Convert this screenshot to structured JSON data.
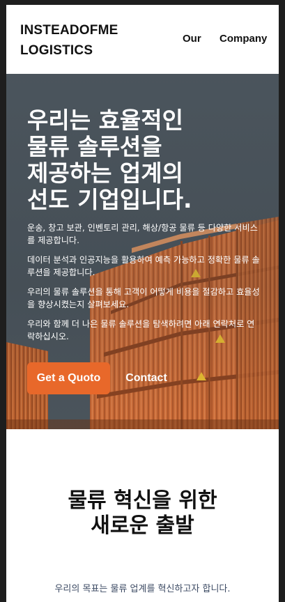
{
  "header": {
    "logo_line1": "INSTEADOFME",
    "logo_line2": "LOGISTICS",
    "nav": [
      {
        "label": "Our"
      },
      {
        "label": "Company"
      }
    ]
  },
  "hero": {
    "title_lines": [
      "우리는 효율적인",
      "물류 솔루션을",
      "제공하는 업계의",
      "선도 기업입니다."
    ],
    "paragraphs": [
      "운송, 창고 보관, 인벤토리 관리, 해상/항공 물류 등 다양한 서비스를 제공합니다.",
      "데이터 분석과 인공지능을 활용하여 예측 가능하고 정확한 물류 솔루션을 제공합니다.",
      "우리의 물류 솔루션을 통해 고객이 어떻게 비용을 절감하고 효율성을 향상시켰는지 살펴보세요.",
      "우리와 함께 더 나은 물류 솔루션을 탐색하려면 아래 연락처로 연락하십시오."
    ],
    "primary_button": "Get a Quoto",
    "secondary_button": "Contact"
  },
  "section2": {
    "title_lines": [
      "물류 혁신을 위한",
      "새로운 출발"
    ],
    "text": "우리의 목표는 물류 업계를 혁신하고자 합니다."
  },
  "colors": {
    "accent": "#e8682a",
    "hero_sky": "#4d575f",
    "container_orange": "#d9743a"
  }
}
